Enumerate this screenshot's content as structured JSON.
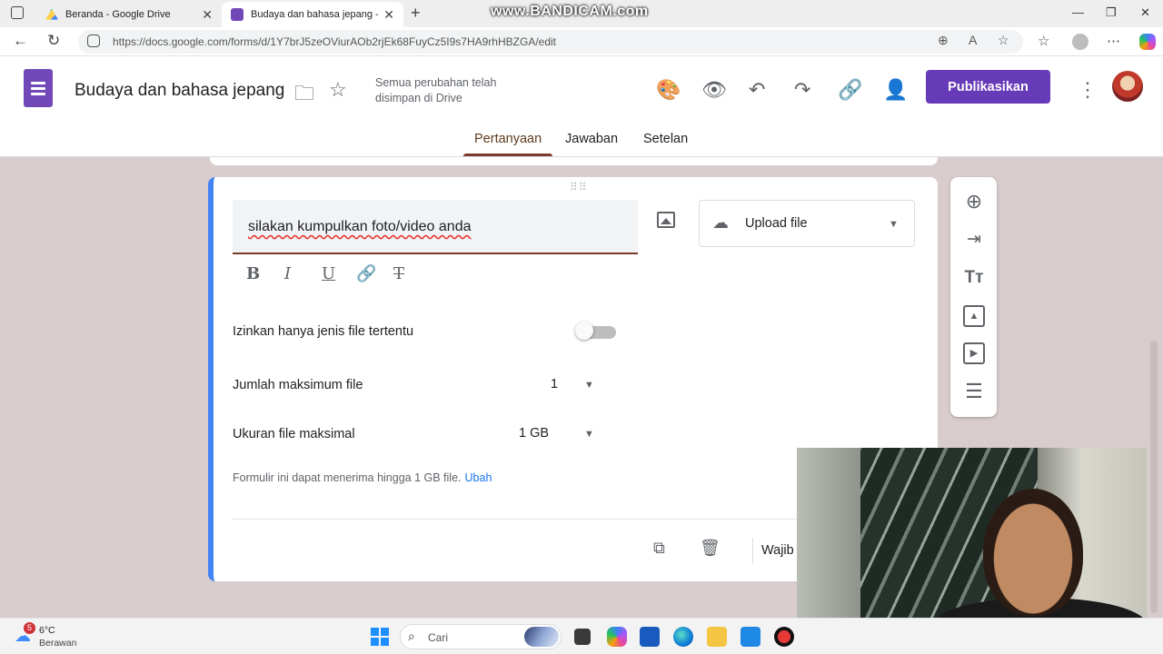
{
  "browser": {
    "tabs": [
      {
        "title": "Beranda - Google Drive",
        "active": false
      },
      {
        "title": "Budaya dan bahasa jepang - Goo",
        "active": true
      }
    ],
    "url": "https://docs.google.com/forms/d/1Y7brJ5zeOViurAOb2rjEk68FuyCz5I9s7HA9rhHBZGA/edit",
    "recorder_watermark": "www.BANDICAM.com"
  },
  "forms_header": {
    "doc_title": "Budaya dan bahasa jepang",
    "save_status": "Semua perubahan telah disimpan di Drive",
    "publish_label": "Publikasikan",
    "tabs": [
      {
        "label": "Pertanyaan",
        "active": true
      },
      {
        "label": "Jawaban",
        "active": false
      },
      {
        "label": "Setelan",
        "active": false
      }
    ]
  },
  "question": {
    "title": "silakan kumpulkan foto/video anda",
    "type_label": "Upload file",
    "specific_types_label": "Izinkan hanya jenis file tertentu",
    "specific_types_enabled": false,
    "max_files_label": "Jumlah maksimum file",
    "max_files_value": "1",
    "max_size_label": "Ukuran file maksimal",
    "max_size_value": "1 GB",
    "hint_text": "Formulir ini dapat menerima hingga 1 GB file.",
    "hint_link": "Ubah",
    "required_label": "Wajib"
  },
  "side_toolbar_icons": [
    "add-question-icon",
    "import-questions-icon",
    "add-title-icon",
    "add-image-icon",
    "add-video-icon",
    "add-section-icon"
  ],
  "taskbar": {
    "weather_temp": "6°C",
    "weather_desc": "Berawan",
    "weather_badge": "5",
    "search_label": "Cari"
  },
  "colors": {
    "forms_purple": "#673ab7",
    "card_accent": "#4285f4",
    "page_background": "#d9cccc",
    "active_tab_underline": "#7a3b2e"
  }
}
